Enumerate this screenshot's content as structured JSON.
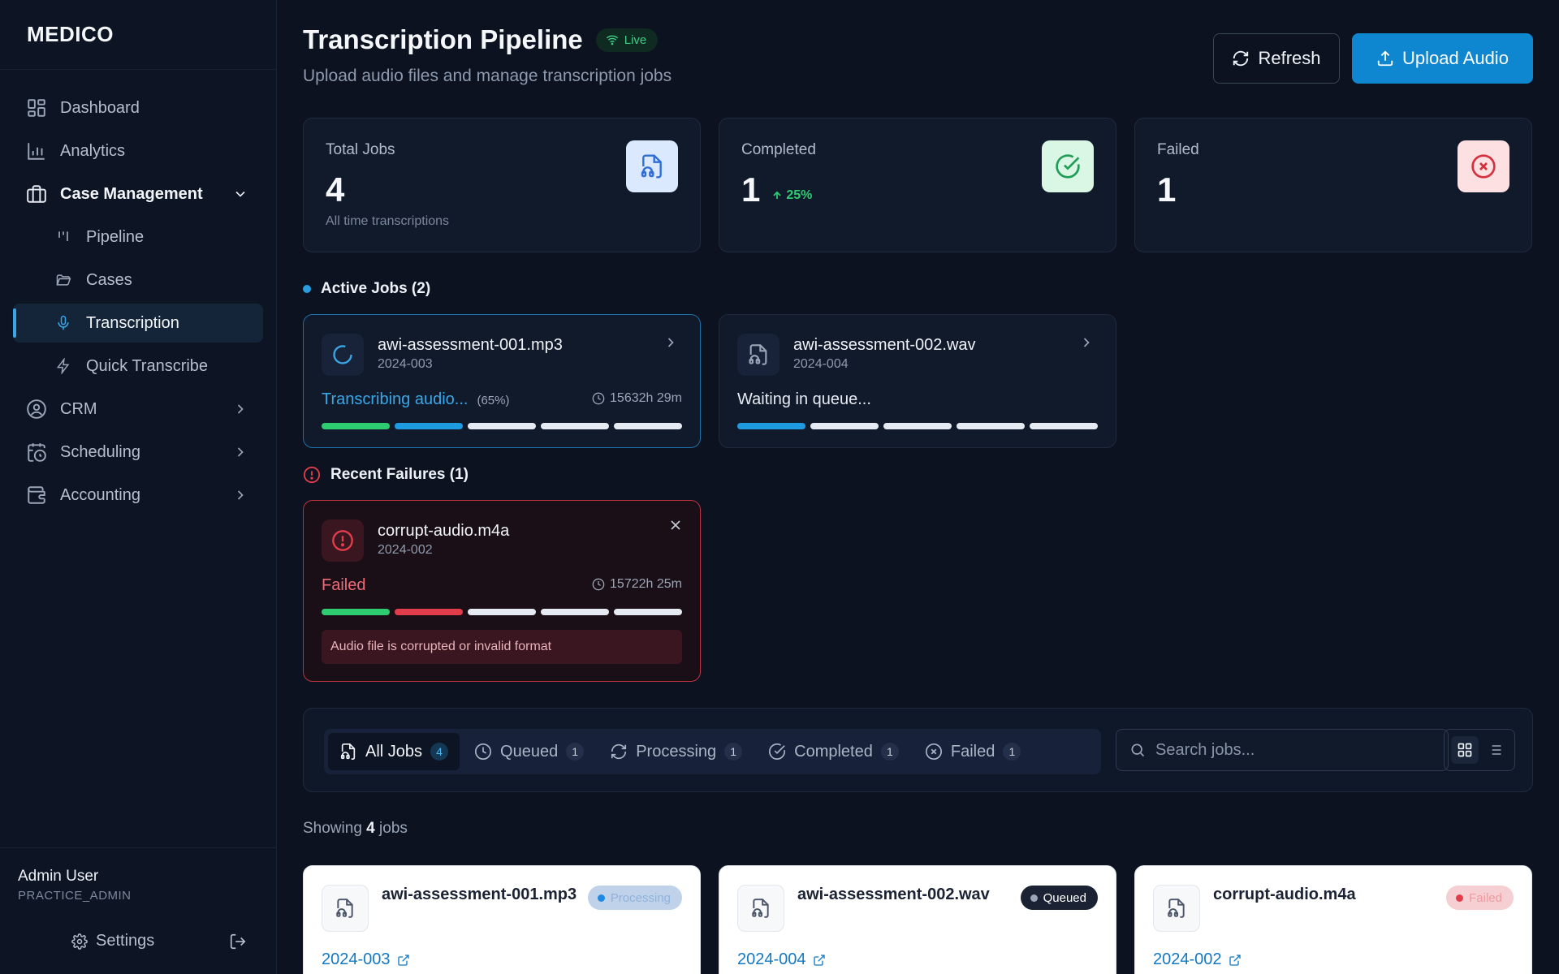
{
  "brand": "MEDICO",
  "nav": {
    "dashboard": "Dashboard",
    "analytics": "Analytics",
    "case_management": "Case Management",
    "pipeline": "Pipeline",
    "cases": "Cases",
    "transcription": "Transcription",
    "quick_transcribe": "Quick Transcribe",
    "crm": "CRM",
    "scheduling": "Scheduling",
    "accounting": "Accounting"
  },
  "user": {
    "name": "Admin User",
    "role": "PRACTICE_ADMIN",
    "settings": "Settings"
  },
  "header": {
    "title": "Transcription Pipeline",
    "live": "Live",
    "subtitle": "Upload audio files and manage transcription jobs",
    "refresh": "Refresh",
    "upload": "Upload Audio"
  },
  "stats": {
    "total": {
      "label": "Total Jobs",
      "value": "4",
      "sub": "All time transcriptions"
    },
    "completed": {
      "label": "Completed",
      "value": "1",
      "trend": "25%"
    },
    "failed": {
      "label": "Failed",
      "value": "1"
    }
  },
  "active_jobs": {
    "title": "Active Jobs (2)",
    "items": [
      {
        "name": "awi-assessment-001.mp3",
        "case": "2024-003",
        "status": "Transcribing audio...",
        "pct": "(65%)",
        "time": "15632h 29m"
      },
      {
        "name": "awi-assessment-002.wav",
        "case": "2024-004",
        "status": "Waiting in queue..."
      }
    ]
  },
  "failures": {
    "title": "Recent Failures (1)",
    "items": [
      {
        "name": "corrupt-audio.m4a",
        "case": "2024-002",
        "status": "Failed",
        "time": "15722h 25m",
        "error": "Audio file is corrupted or invalid format"
      }
    ]
  },
  "filters": {
    "tabs": [
      {
        "label": "All Jobs",
        "count": "4"
      },
      {
        "label": "Queued",
        "count": "1"
      },
      {
        "label": "Processing",
        "count": "1"
      },
      {
        "label": "Completed",
        "count": "1"
      },
      {
        "label": "Failed",
        "count": "1"
      }
    ],
    "search_placeholder": "Search jobs..."
  },
  "showing": {
    "prefix": "Showing",
    "count": "4",
    "suffix": "jobs"
  },
  "job_grid": [
    {
      "name": "awi-assessment-001.mp3",
      "status": "Processing",
      "case": "2024-003"
    },
    {
      "name": "awi-assessment-002.wav",
      "status": "Queued",
      "case": "2024-004"
    },
    {
      "name": "corrupt-audio.m4a",
      "status": "Failed",
      "case": "2024-002"
    }
  ],
  "colors": {
    "accent": "#0f86d0",
    "success": "#2ecc71",
    "danger": "#e23d4b",
    "background": "#0c1220"
  }
}
